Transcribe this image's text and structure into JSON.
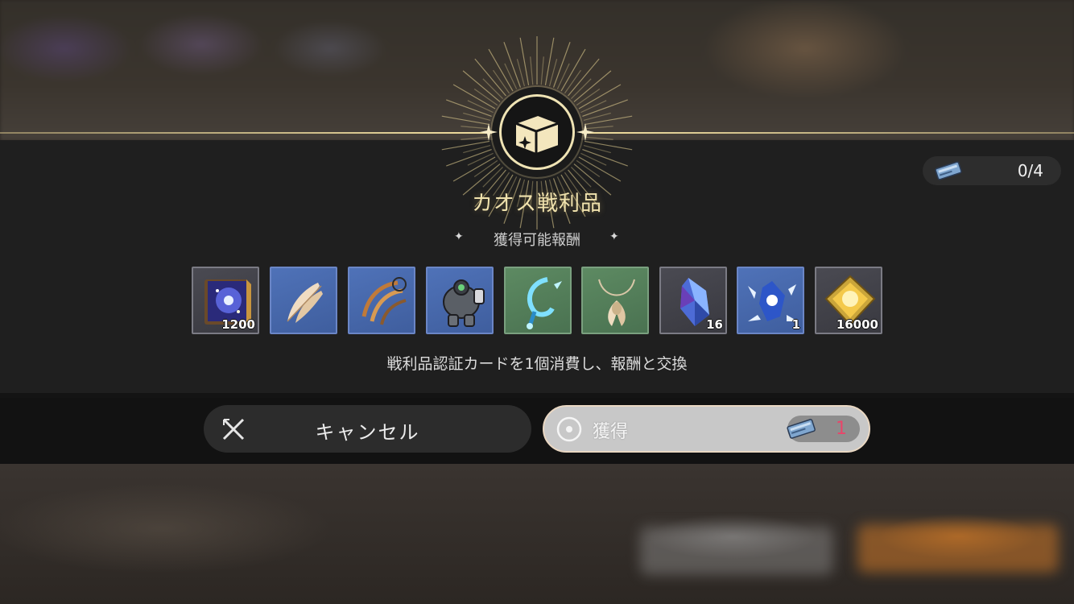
{
  "dialog": {
    "title": "カオス戦利品",
    "subtitle": "獲得可能報酬",
    "description": "戦利品認証カードを1個消費し、報酬と交換",
    "ticket_count": "0/4"
  },
  "rewards": [
    {
      "name": "star-tome",
      "rarity": "grey",
      "quantity": "1200"
    },
    {
      "name": "feather-wing",
      "rarity": "blue",
      "quantity": ""
    },
    {
      "name": "golden-ornament",
      "rarity": "blue",
      "quantity": ""
    },
    {
      "name": "robot-suit",
      "rarity": "blue",
      "quantity": ""
    },
    {
      "name": "blue-hook-charm",
      "rarity": "green",
      "quantity": ""
    },
    {
      "name": "feather-necklace",
      "rarity": "green",
      "quantity": ""
    },
    {
      "name": "crystal-shard",
      "rarity": "grey",
      "quantity": "16"
    },
    {
      "name": "ice-crystal",
      "rarity": "blue",
      "quantity": "1"
    },
    {
      "name": "gold-chip",
      "rarity": "grey",
      "quantity": "16000"
    }
  ],
  "buttons": {
    "cancel_label": "キャンセル",
    "obtain_label": "獲得",
    "obtain_cost": "1"
  },
  "colors": {
    "accent_gold": "#f0e2ad",
    "cost_red": "#e8466a",
    "panel": "#1f1f1f"
  },
  "icons": [
    "chest-icon",
    "ticket-icon",
    "close-icon",
    "confirm-circle-icon",
    "sparkle-icon"
  ]
}
